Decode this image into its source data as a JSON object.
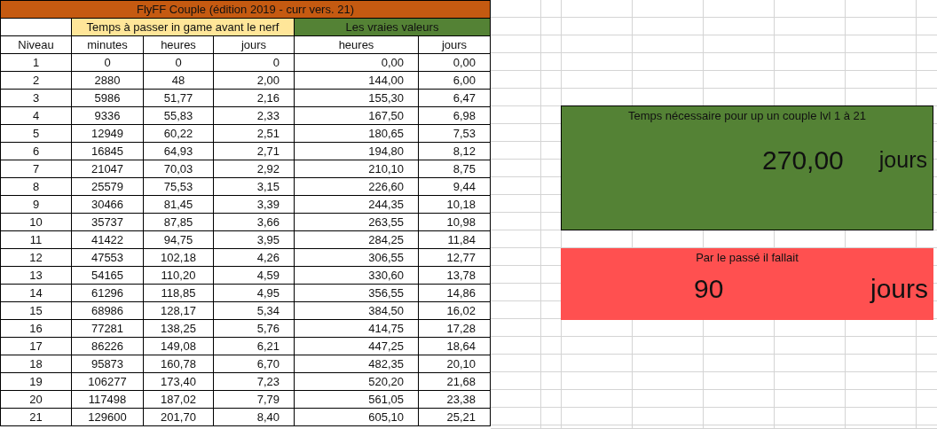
{
  "sheet_title": "FlyFF Couple (édition 2019 - curr vers. 21)",
  "header_groups": [
    {
      "label": "Temps à passer in game avant le nerf",
      "color": "#ffe699"
    },
    {
      "label": "Les vraies valeurs",
      "color": "#548235"
    }
  ],
  "columns": [
    "Niveau",
    "minutes",
    "heures",
    "jours",
    "heures",
    "jours"
  ],
  "rows": [
    [
      "1",
      "0",
      "0",
      "0",
      "0,00",
      "0,00"
    ],
    [
      "2",
      "2880",
      "48",
      "2,00",
      "144,00",
      "6,00"
    ],
    [
      "3",
      "5986",
      "51,77",
      "2,16",
      "155,30",
      "6,47"
    ],
    [
      "4",
      "9336",
      "55,83",
      "2,33",
      "167,50",
      "6,98"
    ],
    [
      "5",
      "12949",
      "60,22",
      "2,51",
      "180,65",
      "7,53"
    ],
    [
      "6",
      "16845",
      "64,93",
      "2,71",
      "194,80",
      "8,12"
    ],
    [
      "7",
      "21047",
      "70,03",
      "2,92",
      "210,10",
      "8,75"
    ],
    [
      "8",
      "25579",
      "75,53",
      "3,15",
      "226,60",
      "9,44"
    ],
    [
      "9",
      "30466",
      "81,45",
      "3,39",
      "244,35",
      "10,18"
    ],
    [
      "10",
      "35737",
      "87,85",
      "3,66",
      "263,55",
      "10,98"
    ],
    [
      "11",
      "41422",
      "94,75",
      "3,95",
      "284,25",
      "11,84"
    ],
    [
      "12",
      "47553",
      "102,18",
      "4,26",
      "306,55",
      "12,77"
    ],
    [
      "13",
      "54165",
      "110,20",
      "4,59",
      "330,60",
      "13,78"
    ],
    [
      "14",
      "61296",
      "118,85",
      "4,95",
      "356,55",
      "14,86"
    ],
    [
      "15",
      "68986",
      "128,17",
      "5,34",
      "384,50",
      "16,02"
    ],
    [
      "16",
      "77281",
      "138,25",
      "5,76",
      "414,75",
      "17,28"
    ],
    [
      "17",
      "86226",
      "149,08",
      "6,21",
      "447,25",
      "18,64"
    ],
    [
      "18",
      "95873",
      "160,78",
      "6,70",
      "482,35",
      "20,10"
    ],
    [
      "19",
      "106277",
      "173,40",
      "7,23",
      "520,20",
      "21,68"
    ],
    [
      "20",
      "117498",
      "187,02",
      "7,79",
      "561,05",
      "23,38"
    ],
    [
      "21",
      "129600",
      "201,70",
      "8,40",
      "605,10",
      "25,21"
    ]
  ],
  "summary_panels": [
    {
      "caption": "Temps nécessaire pour up un couple lvl 1 à 21",
      "value": "270,00",
      "unit": "jours",
      "color": "#548235"
    },
    {
      "caption": "Par le passé il fallait",
      "value": "90",
      "unit": "jours",
      "color": "#ff5050"
    }
  ]
}
